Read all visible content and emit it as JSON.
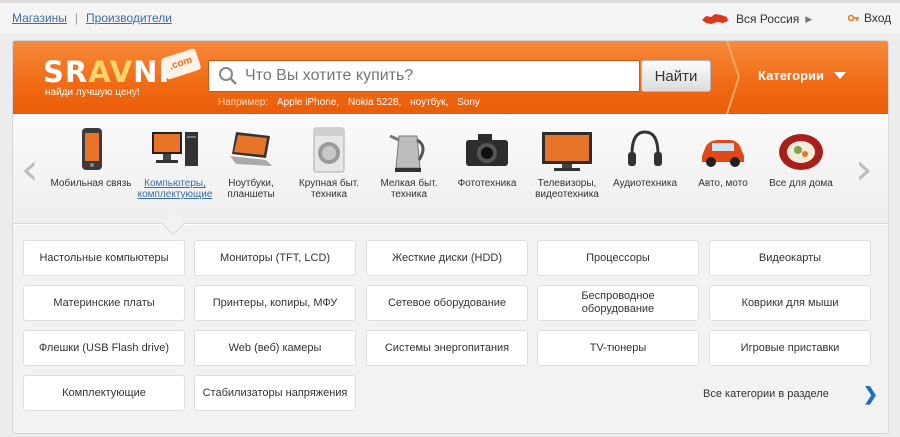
{
  "topbar": {
    "links": [
      "Магазины",
      "Производители"
    ],
    "separator": "|",
    "region": "Вся Россия",
    "login": "Вход"
  },
  "header": {
    "logo_left": "SR",
    "logo_accent": "AV",
    "logo_right": "NI",
    "logo_tag": ".com",
    "slogan": "найди лучшую цену!",
    "search_placeholder": "Что Вы хотите купить?",
    "search_button": "Найти",
    "examples_label": "Например:",
    "examples": [
      "Apple iPhone,",
      "Nokia 5228,",
      "ноутбук,",
      "Sony"
    ],
    "categories_label": "Категории"
  },
  "colors": {
    "brand": "#f06a14",
    "link": "#3a6ea5",
    "arrow": "#1f6fbf"
  },
  "categories": [
    {
      "label": "Мобильная связь",
      "icon": "mobile-phone-icon"
    },
    {
      "label": "Компьютеры, комплектующие",
      "icon": "desktop-computer-icon",
      "active": true
    },
    {
      "label": "Ноутбуки, планшеты",
      "icon": "laptop-icon"
    },
    {
      "label": "Крупная быт. техника",
      "icon": "washing-machine-icon"
    },
    {
      "label": "Мелкая быт. техника",
      "icon": "kettle-icon"
    },
    {
      "label": "Фототехника",
      "icon": "camera-icon"
    },
    {
      "label": "Телевизоры, видеотехника",
      "icon": "tv-icon"
    },
    {
      "label": "Аудиотехника",
      "icon": "headphones-icon"
    },
    {
      "label": "Авто, мото",
      "icon": "car-icon"
    },
    {
      "label": "Все для дома",
      "icon": "plate-icon"
    }
  ],
  "subcategories": [
    "Настольные компьютеры",
    "Мониторы (TFT, LCD)",
    "Жесткие диски (HDD)",
    "Процессоры",
    "Видеокарты",
    "Материнские платы",
    "Принтеры, копиры, МФУ",
    "Сетевое оборудование",
    "Беспроводное оборудование",
    "Коврики для мыши",
    "Флешки (USB Flash drive)",
    "Web (веб) камеры",
    "Системы энергопитания",
    "TV-тюнеры",
    "Игровые приставки",
    "Комплектующие",
    "Стабилизаторы напряжения"
  ],
  "all_categories_link": "Все категории в разделе",
  "nav": {
    "prev": "‹",
    "next": "›",
    "more": "❯"
  }
}
